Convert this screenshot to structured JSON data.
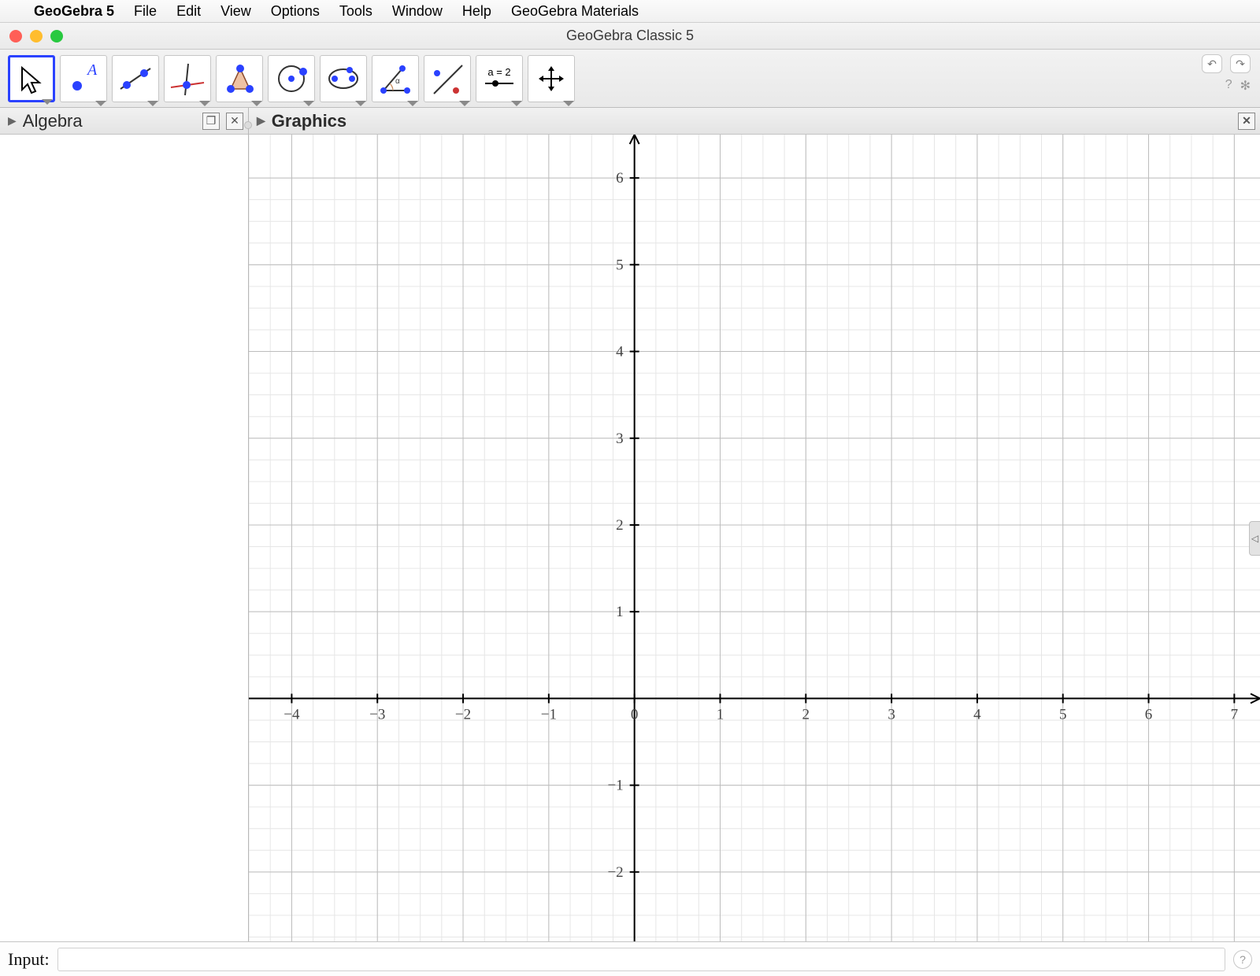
{
  "menubar": {
    "app_name": "GeoGebra 5",
    "items": [
      "File",
      "Edit",
      "View",
      "Options",
      "Tools",
      "Window",
      "Help",
      "GeoGebra Materials"
    ]
  },
  "window": {
    "title": "GeoGebra Classic 5"
  },
  "toolbar": {
    "tools": [
      {
        "name": "move",
        "label": "Move",
        "selected": true
      },
      {
        "name": "point",
        "label": "Point"
      },
      {
        "name": "line",
        "label": "Line"
      },
      {
        "name": "perpendicular",
        "label": "Perpendicular Line"
      },
      {
        "name": "polygon",
        "label": "Polygon"
      },
      {
        "name": "circle",
        "label": "Circle"
      },
      {
        "name": "ellipse",
        "label": "Ellipse"
      },
      {
        "name": "angle",
        "label": "Angle"
      },
      {
        "name": "reflect",
        "label": "Reflect"
      },
      {
        "name": "slider",
        "label": "Slider",
        "text": "a = 2"
      },
      {
        "name": "move-view",
        "label": "Move Graphics View"
      }
    ]
  },
  "panels": {
    "algebra": {
      "title": "Algebra"
    },
    "graphics": {
      "title": "Graphics"
    }
  },
  "input": {
    "label": "Input:",
    "value": ""
  },
  "chart_data": {
    "type": "scatter",
    "x": [],
    "y": [],
    "title": "",
    "xlabel": "",
    "ylabel": "",
    "xlim": [
      -4.5,
      7.3
    ],
    "ylim": [
      -2.8,
      6.5
    ],
    "xticks": [
      -4,
      -3,
      -2,
      -1,
      0,
      1,
      2,
      3,
      4,
      5,
      6,
      7
    ],
    "yticks": [
      -2,
      -1,
      1,
      2,
      3,
      4,
      5,
      6
    ],
    "grid": true
  }
}
